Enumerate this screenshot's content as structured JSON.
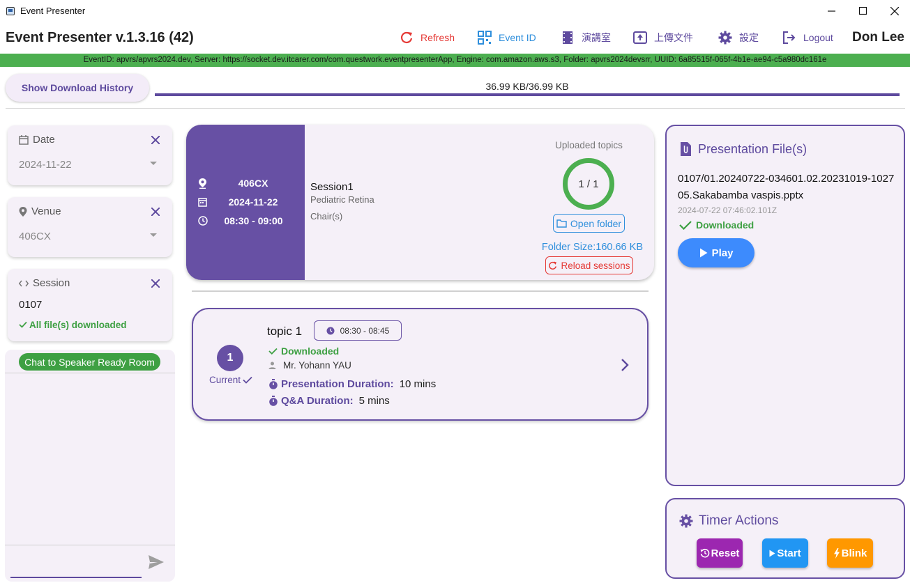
{
  "window": {
    "title": "Event Presenter"
  },
  "header": {
    "app_title": "Event Presenter v.1.3.16 (42)",
    "nav": {
      "refresh": "Refresh",
      "event_id": "Event ID",
      "lecture_room": "演講室",
      "upload_file": "上傳文件",
      "settings": "設定",
      "logout": "Logout"
    },
    "user_name": "Don Lee"
  },
  "info_bar": "EventID: apvrs/apvrs2024.dev, Server: https://socket.dev.itcarer.com/com.questwork.eventpresenterApp, Engine: com.amazon.aws.s3, Folder: apvrs2024devsrr, UUID: 6a85515f-065f-4b1e-ae94-c5a980dc161e",
  "download": {
    "history_button": "Show Download History",
    "progress_text": "36.99 KB/36.99 KB",
    "progress_fraction": 1.0
  },
  "filters": {
    "date": {
      "label": "Date",
      "value": "2024-11-22"
    },
    "venue": {
      "label": "Venue",
      "value": "406CX"
    },
    "session": {
      "label": "Session",
      "value": "0107",
      "status": "All file(s) downloaded"
    }
  },
  "chat": {
    "button": "Chat to Speaker Ready Room"
  },
  "session_card": {
    "venue": "406CX",
    "date": "2024-11-22",
    "time": "08:30 - 09:00",
    "name": "Session1",
    "subtitle": "Pediatric Retina",
    "chair_label": "Chair(s)",
    "uploaded_label": "Uploaded topics",
    "uploaded_count": "1 / 1",
    "open_folder": "Open folder",
    "folder_size": "Folder Size:160.66 KB",
    "reload": "Reload sessions"
  },
  "topic": {
    "number": "1",
    "current_label": "Current",
    "title": "topic 1",
    "time": "08:30 - 08:45",
    "status": "Downloaded",
    "speaker": "Mr. Yohann YAU",
    "presentation_label": "Presentation Duration:",
    "presentation_value": "10 mins",
    "qa_label": "Q&A Duration:",
    "qa_value": "5 mins"
  },
  "files_panel": {
    "title": "Presentation File(s)",
    "file_name": "0107/01.20240722-034601.02.20231019-102705.Sakabamba vaspis.pptx",
    "file_time": "2024-07-22 07:46:02.101Z",
    "file_status": "Downloaded",
    "play": "Play"
  },
  "timer_panel": {
    "title": "Timer Actions",
    "reset": "Reset",
    "start": "Start",
    "blink": "Blink"
  },
  "colors": {
    "primary": "#6750a4",
    "success": "#4caf50",
    "danger": "#e53935",
    "info": "#2f8fdc",
    "play": "#3d8bfd",
    "reset": "#9c27b0",
    "start": "#2196f3",
    "blink": "#ff9800"
  }
}
